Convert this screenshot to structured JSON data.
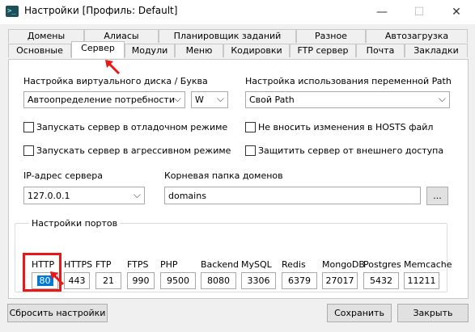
{
  "window": {
    "title": "Настройки [Профиль: Default]",
    "minimize": "—",
    "maximize": "☐",
    "close": "✕"
  },
  "tabs_row1": [
    "Домены",
    "Алиасы",
    "Планировщик заданий",
    "Разное",
    "Автозагрузка"
  ],
  "tabs_row2": [
    "Основные",
    "Сервер",
    "Модули",
    "Меню",
    "Кодировки",
    "FTP сервер",
    "Почта",
    "Закладки"
  ],
  "active_tab": "Сервер",
  "server": {
    "vdisk_label": "Настройка виртуального диска / Буква",
    "vdisk_value": "Автоопределение потребности",
    "letter_value": "W",
    "path_label": "Настройка использования переменной Path",
    "path_value": "Свой Path",
    "debug_label": "Запускать сервер в отладочном режиме",
    "aggressive_label": "Запускать сервер в агрессивном режиме",
    "hosts_label": "Не вносить изменения в HOSTS файл",
    "protect_label": "Защитить сервер от внешнего доступа",
    "ip_label": "IP-адрес сервера",
    "ip_value": "127.0.0.1",
    "root_label": "Корневая папка доменов",
    "root_value": "domains",
    "browse_label": "...",
    "ports_title": "Настройки портов",
    "ports": [
      {
        "name": "HTTP",
        "value": "80"
      },
      {
        "name": "HTTPS",
        "value": "443"
      },
      {
        "name": "FTP",
        "value": "21"
      },
      {
        "name": "FTPS",
        "value": "990"
      },
      {
        "name": "PHP",
        "value": "9500"
      },
      {
        "name": "Backend",
        "value": "8080"
      },
      {
        "name": "MySQL",
        "value": "3306"
      },
      {
        "name": "Redis",
        "value": "6379"
      },
      {
        "name": "MongoDB",
        "value": "27017"
      },
      {
        "name": "Postgres",
        "value": "5432"
      },
      {
        "name": "Memcache",
        "value": "11211"
      }
    ]
  },
  "footer": {
    "reset_label": "Сбросить настройки",
    "save_label": "Сохранить",
    "close_label": "Закрыть"
  },
  "colors": {
    "highlight": "#e81818",
    "selection": "#0078d7"
  }
}
